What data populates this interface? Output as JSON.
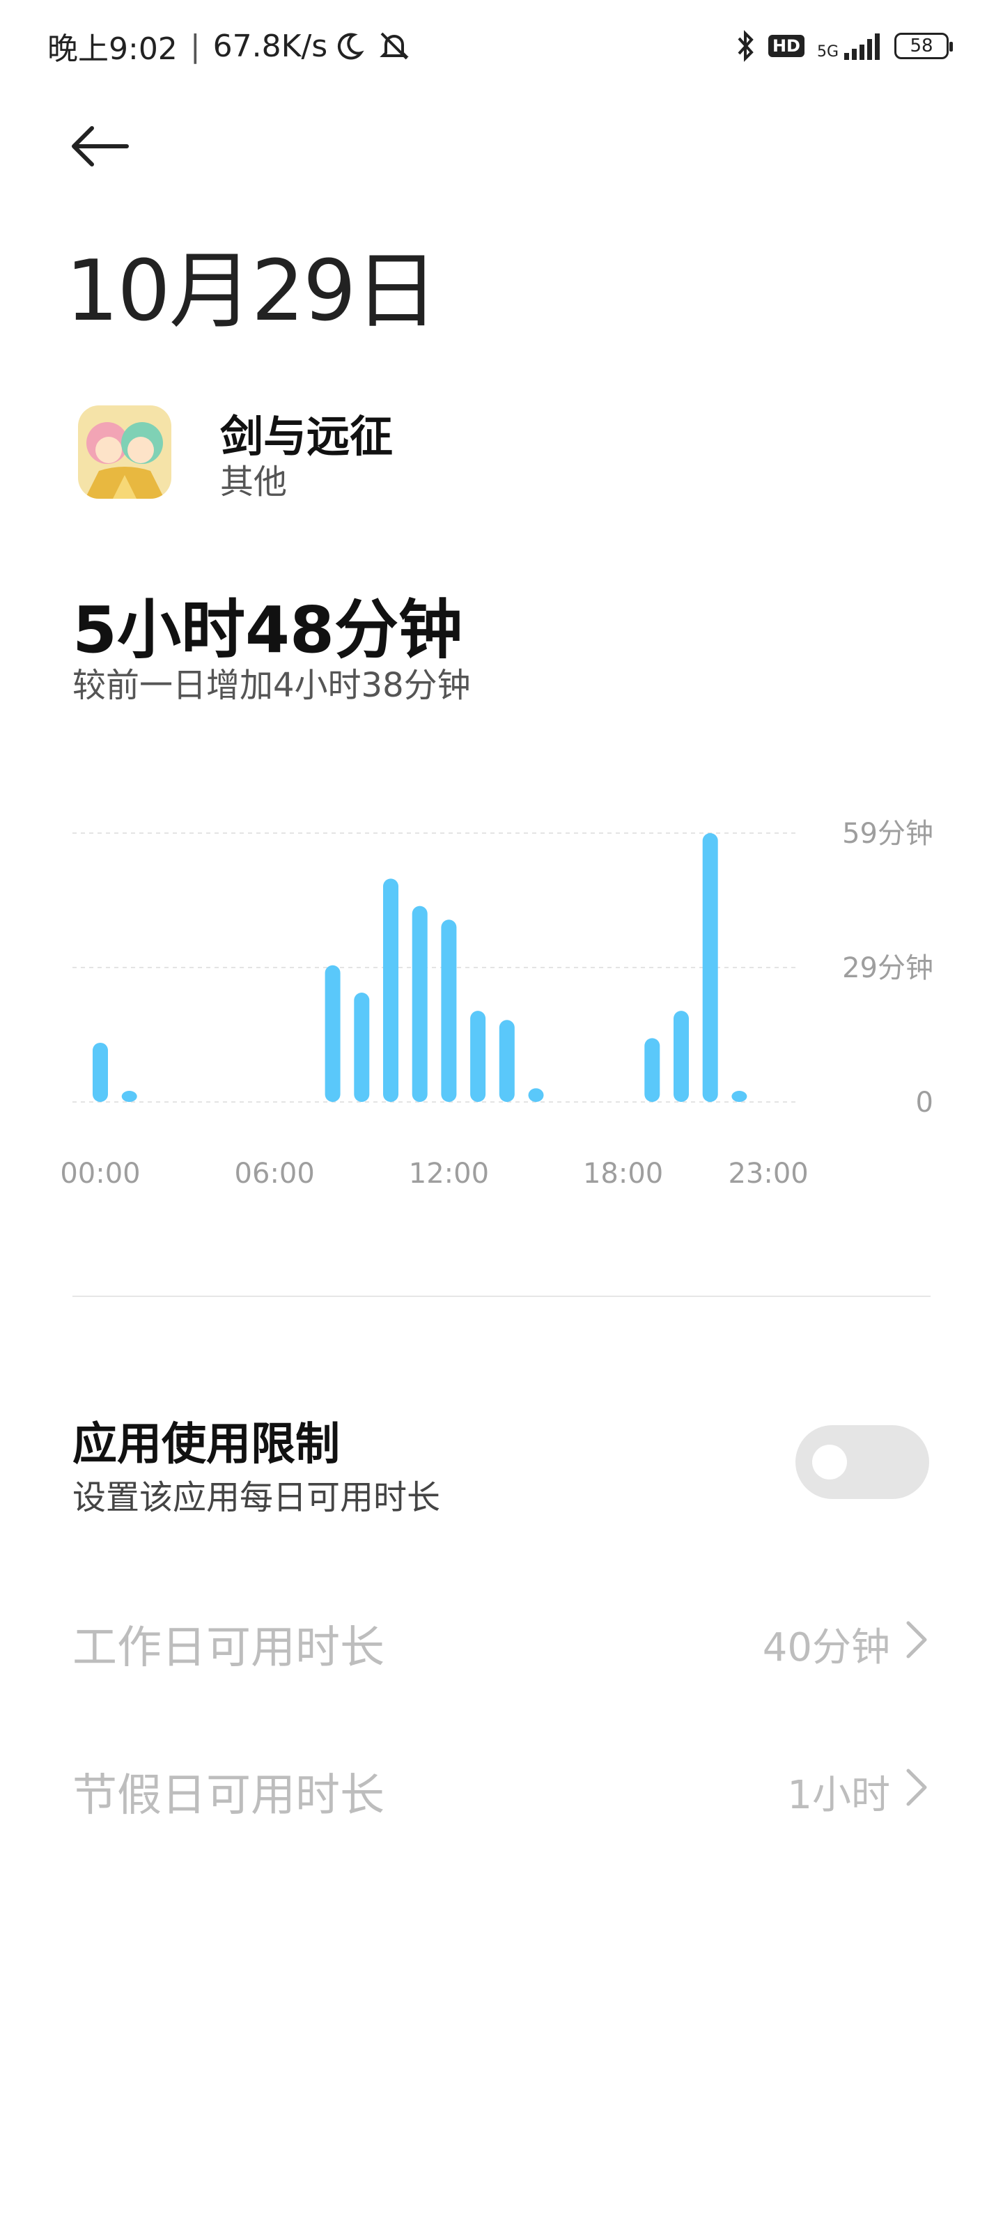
{
  "status_bar": {
    "time": "晚上9:02",
    "separator": "|",
    "speed": "67.8K/s",
    "net_label": "5G",
    "hd_label": "HD",
    "battery": "58",
    "icons": [
      "moon-icon",
      "alarm-off-icon",
      "bluetooth-icon",
      "signal-icon"
    ]
  },
  "header": {
    "back": "back-arrow-icon",
    "date": "10月29日"
  },
  "app": {
    "name": "剑与远征",
    "category": "其他"
  },
  "usage": {
    "total": "5小时48分钟",
    "compare": "较前一日增加4小时38分钟"
  },
  "chart_data": {
    "type": "bar",
    "x_tick_labels": [
      "00:00",
      "06:00",
      "12:00",
      "18:00",
      "23:00"
    ],
    "y_tick_labels": [
      "59分钟",
      "29分钟",
      "0"
    ],
    "ylim": [
      0,
      59
    ],
    "unit": "分钟",
    "grid": true,
    "bar_color": "#5ac8fa",
    "x": [
      0,
      1,
      2,
      3,
      4,
      5,
      6,
      7,
      8,
      9,
      10,
      11,
      12,
      13,
      14,
      15,
      16,
      17,
      18,
      19,
      20,
      21,
      22,
      23
    ],
    "values": [
      13,
      2,
      0,
      0,
      0,
      0,
      0,
      0,
      30,
      24,
      49,
      43,
      40,
      20,
      18,
      3,
      0,
      0,
      0,
      14,
      20,
      59,
      2,
      0
    ]
  },
  "limit": {
    "title": "应用使用限制",
    "subtitle": "设置该应用每日可用时长",
    "enabled": false
  },
  "rows": [
    {
      "label": "工作日可用时长",
      "value": "40分钟"
    },
    {
      "label": "节假日可用时长",
      "value": "1小时"
    }
  ],
  "colors": {
    "accent": "#5ac8fa",
    "disabled_text": "#bdbdbd",
    "toggle_off": "#e5e5e5"
  }
}
